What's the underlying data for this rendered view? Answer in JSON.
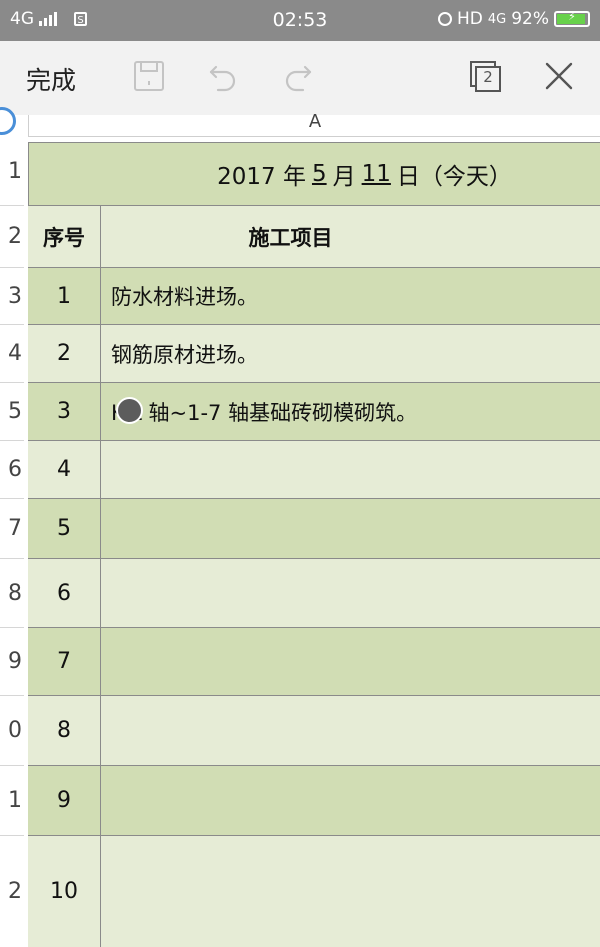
{
  "status_bar": {
    "network": "4G",
    "sim_label": "S",
    "time": "02:53",
    "hd_label": "HD",
    "network_right": "4G",
    "battery": "92%",
    "battery_level": 0.92
  },
  "toolbar": {
    "done_label": "完成",
    "sheet_count": "2"
  },
  "column_header": {
    "col_a": "A"
  },
  "row_numbers": [
    "1",
    "2",
    "3",
    "4",
    "5",
    "6",
    "7",
    "8",
    "9",
    "0",
    "1",
    "2"
  ],
  "sheet": {
    "title": {
      "year": "2017 年",
      "month": "5",
      "month_suffix": "月",
      "day": "11",
      "day_suffix": "日（今天）"
    },
    "headers": {
      "seq": "序号",
      "item": "施工项目"
    },
    "rows": [
      {
        "seq": "1",
        "item": "防水材料进场。"
      },
      {
        "seq": "2",
        "item": "钢筋原材进场。"
      },
      {
        "seq": "3",
        "item": "K-L 轴~1-7 轴基础砖砌模砌筑。"
      },
      {
        "seq": "4",
        "item": ""
      },
      {
        "seq": "5",
        "item": ""
      },
      {
        "seq": "6",
        "item": ""
      },
      {
        "seq": "7",
        "item": ""
      },
      {
        "seq": "8",
        "item": ""
      },
      {
        "seq": "9",
        "item": ""
      },
      {
        "seq": "10",
        "item": ""
      }
    ]
  },
  "colors": {
    "status_bar_bg": "#8a8a8a",
    "toolbar_bg": "#f2f2f2",
    "row_dark": "#d1ddb4",
    "row_light": "#e6ecd6",
    "battery_green": "#68d14b"
  }
}
